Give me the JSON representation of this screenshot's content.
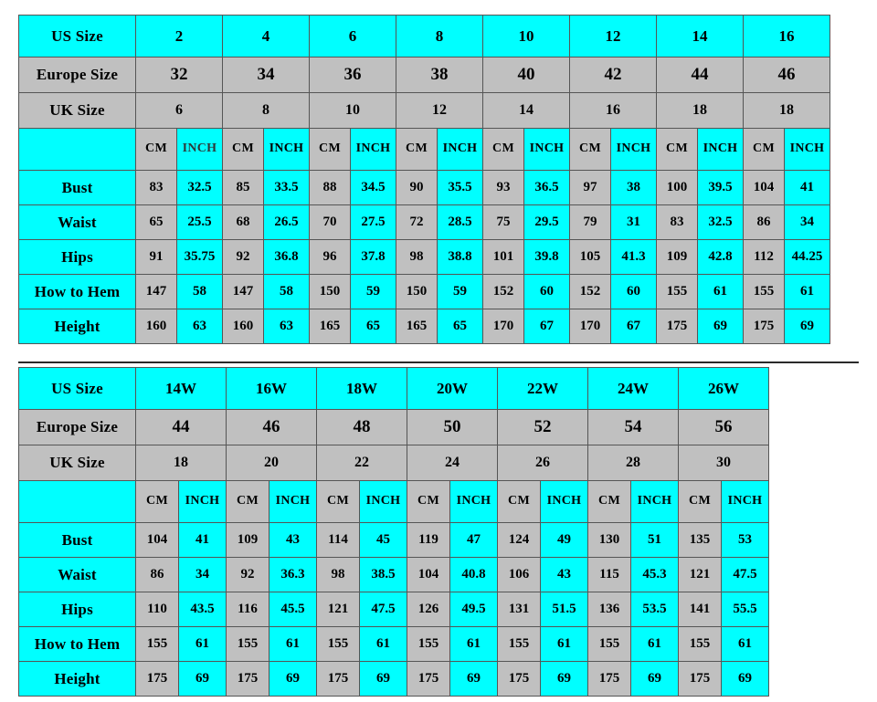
{
  "meta": {
    "colors": {
      "cyan": "#00ffff",
      "gray": "#c0c0c0",
      "border": "#555555",
      "text": "#000000",
      "faded_text": "#4a5a5a",
      "background": "#ffffff"
    }
  },
  "labels": {
    "us_size": "US Size",
    "europe_size": "Europe Size",
    "uk_size": "UK Size",
    "blank": "",
    "cm": "CM",
    "inch": "INCH",
    "bust": "Bust",
    "waist": "Waist",
    "hips": "Hips",
    "how_to_hem": "How to Hem",
    "height": "Height"
  },
  "chart_data": [
    {
      "type": "table",
      "name": "standard-sizes",
      "title": "Standard Size Chart",
      "row_headers": [
        "US Size",
        "Europe Size",
        "UK Size",
        "",
        "Bust",
        "Waist",
        "Hips",
        "How to Hem",
        "Height"
      ],
      "us_sizes": [
        "2",
        "4",
        "6",
        "8",
        "10",
        "12",
        "14",
        "16"
      ],
      "europe_sizes": [
        "32",
        "34",
        "36",
        "38",
        "40",
        "42",
        "44",
        "46"
      ],
      "uk_sizes": [
        "6",
        "8",
        "10",
        "12",
        "14",
        "16",
        "18",
        "18"
      ],
      "unit_headers": [
        "CM",
        "INCH"
      ],
      "measurements": [
        {
          "label": "Bust",
          "cm": [
            "83",
            "85",
            "88",
            "90",
            "93",
            "97",
            "100",
            "104"
          ],
          "inch": [
            "32.5",
            "33.5",
            "34.5",
            "35.5",
            "36.5",
            "38",
            "39.5",
            "41"
          ]
        },
        {
          "label": "Waist",
          "cm": [
            "65",
            "68",
            "70",
            "72",
            "75",
            "79",
            "83",
            "86"
          ],
          "inch": [
            "25.5",
            "26.5",
            "27.5",
            "28.5",
            "29.5",
            "31",
            "32.5",
            "34"
          ]
        },
        {
          "label": "Hips",
          "cm": [
            "91",
            "92",
            "96",
            "98",
            "101",
            "105",
            "109",
            "112"
          ],
          "inch": [
            "35.75",
            "36.8",
            "37.8",
            "38.8",
            "39.8",
            "41.3",
            "42.8",
            "44.25"
          ]
        },
        {
          "label": "How to Hem",
          "cm": [
            "147",
            "147",
            "150",
            "150",
            "152",
            "152",
            "155",
            "155"
          ],
          "inch": [
            "58",
            "58",
            "59",
            "59",
            "60",
            "60",
            "61",
            "61"
          ]
        },
        {
          "label": "Height",
          "cm": [
            "160",
            "160",
            "165",
            "165",
            "170",
            "170",
            "175",
            "175"
          ],
          "inch": [
            "63",
            "63",
            "65",
            "65",
            "67",
            "67",
            "69",
            "69"
          ]
        }
      ]
    },
    {
      "type": "table",
      "name": "plus-sizes",
      "title": "Plus Size Chart",
      "row_headers": [
        "US Size",
        "Europe Size",
        "UK Size",
        "",
        "Bust",
        "Waist",
        "Hips",
        "How to Hem",
        "Height"
      ],
      "us_sizes": [
        "14W",
        "16W",
        "18W",
        "20W",
        "22W",
        "24W",
        "26W"
      ],
      "europe_sizes": [
        "44",
        "46",
        "48",
        "50",
        "52",
        "54",
        "56"
      ],
      "uk_sizes": [
        "18",
        "20",
        "22",
        "24",
        "26",
        "28",
        "30"
      ],
      "unit_headers": [
        "CM",
        "INCH"
      ],
      "measurements": [
        {
          "label": "Bust",
          "cm": [
            "104",
            "109",
            "114",
            "119",
            "124",
            "130",
            "135"
          ],
          "inch": [
            "41",
            "43",
            "45",
            "47",
            "49",
            "51",
            "53"
          ]
        },
        {
          "label": "Waist",
          "cm": [
            "86",
            "92",
            "98",
            "104",
            "106",
            "115",
            "121"
          ],
          "inch": [
            "34",
            "36.3",
            "38.5",
            "40.8",
            "43",
            "45.3",
            "47.5"
          ]
        },
        {
          "label": "Hips",
          "cm": [
            "110",
            "116",
            "121",
            "126",
            "131",
            "136",
            "141"
          ],
          "inch": [
            "43.5",
            "45.5",
            "47.5",
            "49.5",
            "51.5",
            "53.5",
            "55.5"
          ]
        },
        {
          "label": "How to Hem",
          "cm": [
            "155",
            "155",
            "155",
            "155",
            "155",
            "155",
            "155"
          ],
          "inch": [
            "61",
            "61",
            "61",
            "61",
            "61",
            "61",
            "61"
          ]
        },
        {
          "label": "Height",
          "cm": [
            "175",
            "175",
            "175",
            "175",
            "175",
            "175",
            "175"
          ],
          "inch": [
            "69",
            "69",
            "69",
            "69",
            "69",
            "69",
            "69"
          ]
        }
      ]
    }
  ]
}
